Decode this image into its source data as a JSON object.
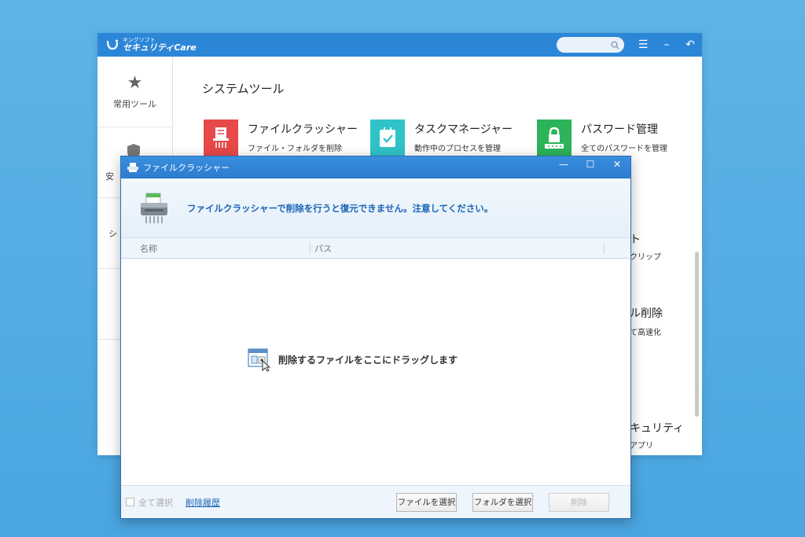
{
  "app": {
    "logo_small": "キングソフト",
    "logo_main": "セキュリティCare",
    "sidebar": [
      {
        "icon": "star-icon",
        "label": "常用ツール"
      },
      {
        "icon": "shield-icon",
        "label": "安"
      },
      {
        "icon": "",
        "label": "シ"
      }
    ],
    "section_title": "システムツール",
    "tools": [
      {
        "name": "ファイルクラッシャー",
        "desc": "ファイル・フォルダを削除",
        "color": "#e84848"
      },
      {
        "name": "タスクマネージャー",
        "desc": "動作中のプロセスを管理",
        "color": "#2fc3c8"
      },
      {
        "name": "パスワード管理",
        "desc": "全てのパスワードを管理",
        "color": "#2db35a"
      }
    ],
    "partial_items": [
      {
        "label": "ト",
        "desc": "クリップ"
      },
      {
        "label": "ル削除",
        "desc": "て高速化"
      },
      {
        "label": "キュリティ",
        "desc": "アプリ"
      }
    ]
  },
  "dialog": {
    "title": "ファイルクラッシャー",
    "warning": "ファイルクラッシャーで削除を行うと復元できません。注意してください。",
    "columns": {
      "name": "名称",
      "path": "パス"
    },
    "drop_hint": "削除するファイルをここにドラッグします",
    "select_all": "全て選択",
    "history_link": "削除履歴",
    "buttons": {
      "select_file": "ファイルを選択",
      "select_folder": "フォルダを選択",
      "delete": "削除"
    }
  }
}
